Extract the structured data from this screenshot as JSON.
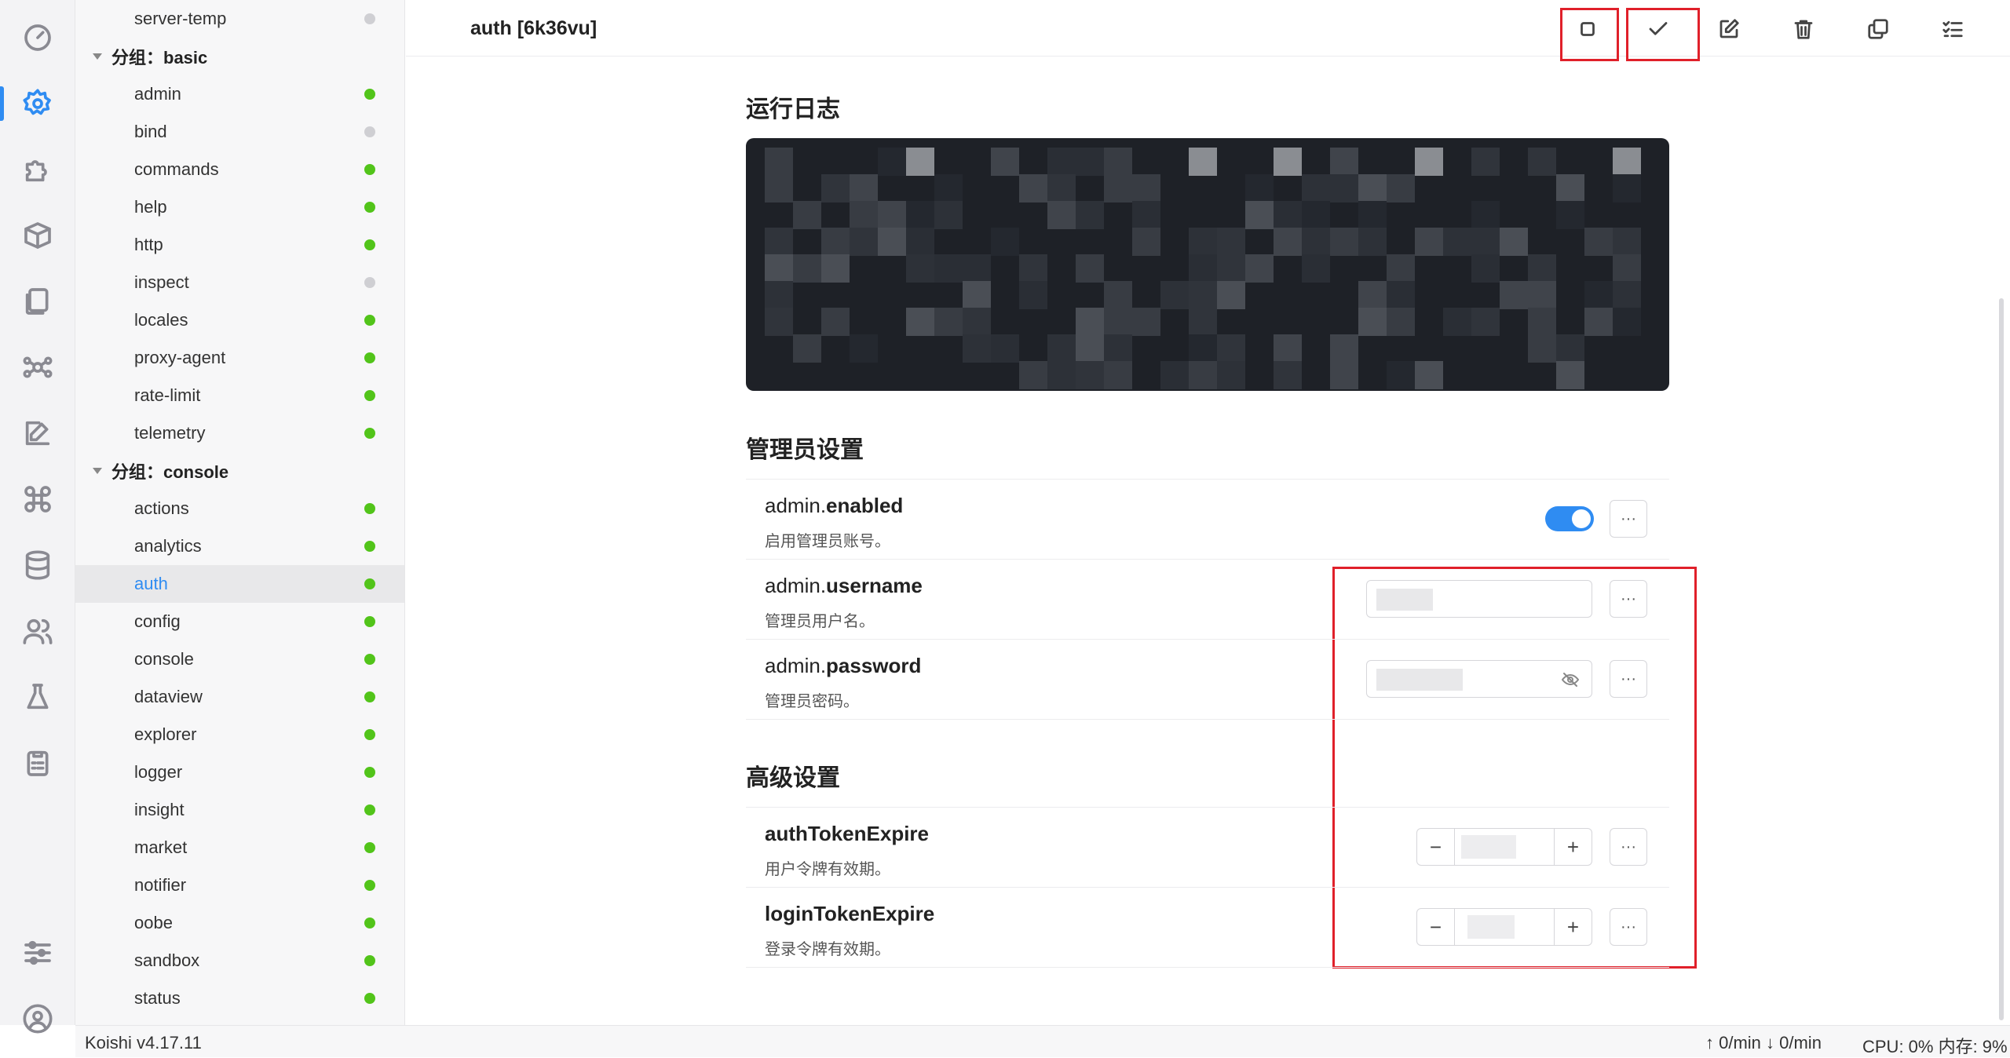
{
  "activity_bar": {
    "icons": [
      "dashboard-icon",
      "settings-icon",
      "plugin-icon",
      "market-box-icon",
      "files-icon",
      "graph-icon",
      "editor-icon",
      "command-icon",
      "database-icon",
      "users-icon",
      "sandbox-flask-icon",
      "clipboard-icon",
      "sliders-icon",
      "account-icon"
    ],
    "active": "settings-icon"
  },
  "tree": {
    "items": [
      {
        "label": "server-temp",
        "status": "stopped"
      },
      {
        "label": "分组：basic",
        "group": true
      },
      {
        "label": "admin",
        "status": "running"
      },
      {
        "label": "bind",
        "status": "stopped"
      },
      {
        "label": "commands",
        "status": "running"
      },
      {
        "label": "help",
        "status": "running"
      },
      {
        "label": "http",
        "status": "running"
      },
      {
        "label": "inspect",
        "status": "stopped"
      },
      {
        "label": "locales",
        "status": "running"
      },
      {
        "label": "proxy-agent",
        "status": "running"
      },
      {
        "label": "rate-limit",
        "status": "running"
      },
      {
        "label": "telemetry",
        "status": "running"
      },
      {
        "label": "分组：console",
        "group": true
      },
      {
        "label": "actions",
        "status": "running"
      },
      {
        "label": "analytics",
        "status": "running"
      },
      {
        "label": "auth",
        "status": "running",
        "selected": true
      },
      {
        "label": "config",
        "status": "running"
      },
      {
        "label": "console",
        "status": "running"
      },
      {
        "label": "dataview",
        "status": "running"
      },
      {
        "label": "explorer",
        "status": "running"
      },
      {
        "label": "logger",
        "status": "running"
      },
      {
        "label": "insight",
        "status": "running"
      },
      {
        "label": "market",
        "status": "running"
      },
      {
        "label": "notifier",
        "status": "running"
      },
      {
        "label": "oobe",
        "status": "running"
      },
      {
        "label": "sandbox",
        "status": "running"
      },
      {
        "label": "status",
        "status": "running"
      }
    ]
  },
  "header": {
    "title": "auth [6k36vu]",
    "actions": [
      "stop-icon",
      "check-icon",
      "edit-icon",
      "trash-icon",
      "copy-icon",
      "checklist-icon"
    ]
  },
  "sections": {
    "log_title": "运行日志",
    "admin_title": "管理员设置",
    "advanced_title": "高级设置"
  },
  "settings": {
    "admin_enabled": {
      "prefix": "admin.",
      "key": "enabled",
      "desc": "启用管理员账号。",
      "value": true
    },
    "admin_username": {
      "prefix": "admin.",
      "key": "username",
      "desc": "管理员用户名。"
    },
    "admin_password": {
      "prefix": "admin.",
      "key": "password",
      "desc": "管理员密码。"
    },
    "auth_token_expire": {
      "key": "authTokenExpire",
      "desc": "用户令牌有效期。"
    },
    "login_token_expire": {
      "key": "loginTokenExpire",
      "desc": "登录令牌有效期。"
    }
  },
  "more_label": "···",
  "stepper": {
    "minus": "−",
    "plus": "+"
  },
  "statusbar": {
    "version": "Koishi v4.17.11",
    "network": "↑ 0/min ↓ 0/min",
    "cpu": "CPU: 0% 内存: 9%"
  },
  "colors": {
    "accent": "#2f8cf2",
    "running": "#52c41a",
    "stopped": "#cfcfd3",
    "highlight": "#e0202a",
    "log_bg": "#1e2127"
  }
}
